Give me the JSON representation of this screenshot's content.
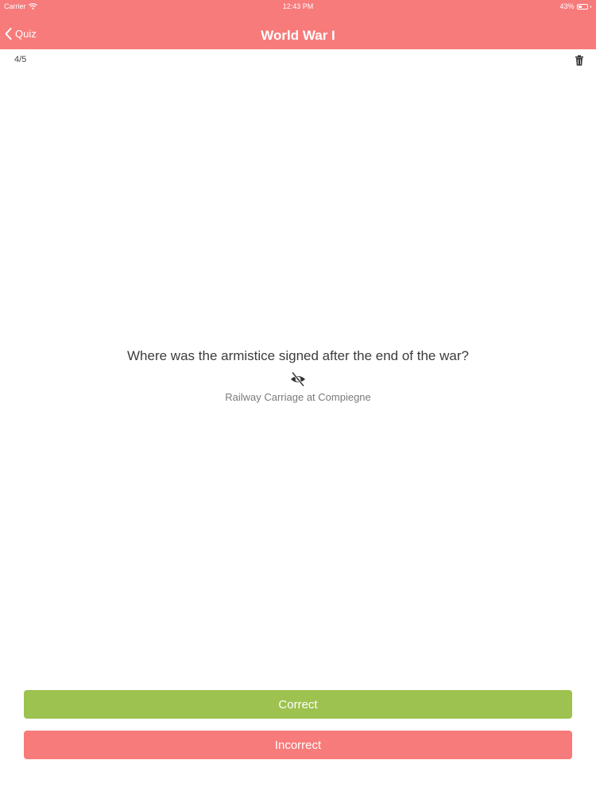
{
  "status_bar": {
    "carrier": "Carrier",
    "time": "12:43 PM",
    "battery": "43%",
    "battery_level": 0.43
  },
  "nav": {
    "back_label": "Quiz",
    "title": "World War I",
    "back_icon": "chevron-left-icon"
  },
  "quiz": {
    "progress": "4/5",
    "question": "Where was the armistice signed after the end of the war?",
    "answer": "Railway Carriage at Compiegne"
  },
  "actions": {
    "correct_label": "Correct",
    "incorrect_label": "Incorrect"
  },
  "colors": {
    "accent": "#f77b7b",
    "correct": "#9dc250",
    "incorrect": "#f77b7b"
  }
}
